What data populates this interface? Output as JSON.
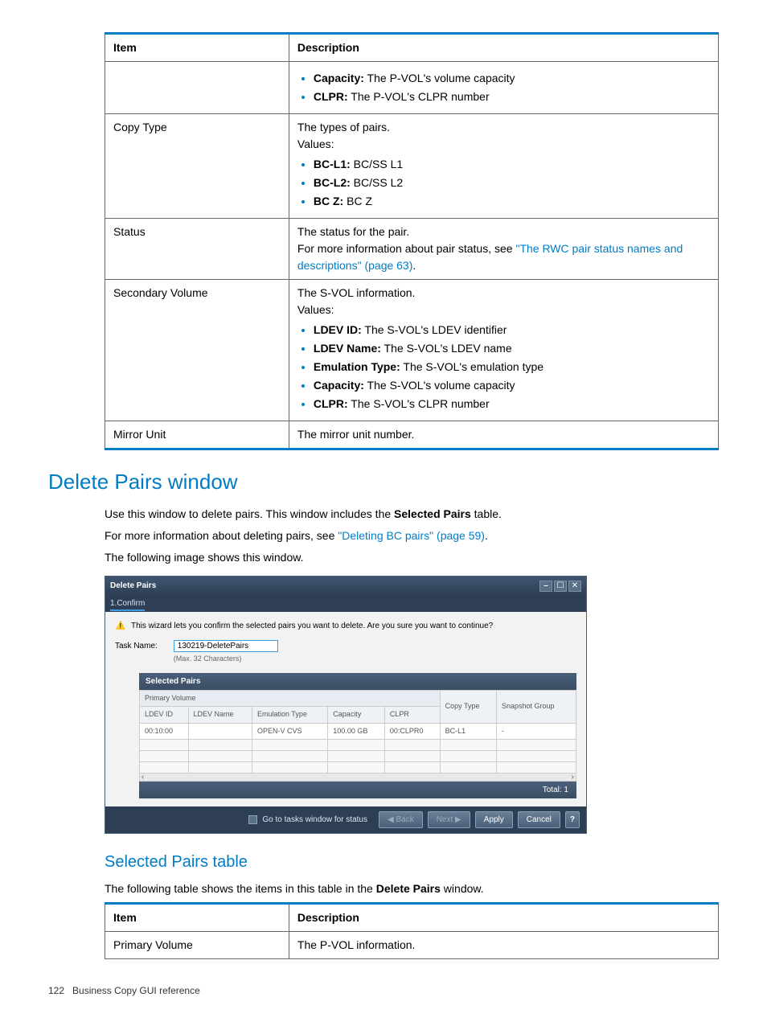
{
  "table1": {
    "headers": [
      "Item",
      "Description"
    ],
    "rows": [
      {
        "item": "",
        "bullets": [
          {
            "b": "Capacity:",
            "t": " The P-VOL's volume capacity"
          },
          {
            "b": "CLPR:",
            "t": " The P-VOL's CLPR number"
          }
        ]
      },
      {
        "item": "Copy Type",
        "lead": [
          "The types of pairs.",
          "Values:"
        ],
        "bullets": [
          {
            "b": "BC-L1:",
            "t": " BC/SS L1"
          },
          {
            "b": "BC-L2:",
            "t": " BC/SS L2"
          },
          {
            "b": "BC Z:",
            "t": " BC Z"
          }
        ]
      },
      {
        "item": "Status",
        "plain": "The status for the pair.",
        "linklead": "For more information about pair status, see ",
        "link": "\"The RWC pair status names and descriptions\" (page 63)",
        "tail": "."
      },
      {
        "item": "Secondary Volume",
        "lead": [
          "The S-VOL information.",
          "Values:"
        ],
        "bullets": [
          {
            "b": "LDEV ID:",
            "t": " The S-VOL's LDEV identifier"
          },
          {
            "b": "LDEV Name:",
            "t": " The S-VOL's LDEV name"
          },
          {
            "b": "Emulation Type:",
            "t": " The S-VOL's emulation type"
          },
          {
            "b": "Capacity:",
            "t": " The S-VOL's volume capacity"
          },
          {
            "b": "CLPR:",
            "t": " The S-VOL's CLPR number"
          }
        ]
      },
      {
        "item": "Mirror Unit",
        "plain": "The mirror unit number."
      }
    ]
  },
  "section": {
    "h2": "Delete Pairs window",
    "p1a": "Use this window to delete pairs. This window includes the ",
    "p1b": "Selected Pairs",
    "p1c": " table.",
    "p2a": "For more information about deleting pairs, see ",
    "p2link": "\"Deleting BC pairs\" (page 59)",
    "p2b": ".",
    "p3": "The following image shows this window."
  },
  "dialog": {
    "title": "Delete Pairs",
    "tab": "1.Confirm",
    "warn": "This wizard lets you confirm the selected pairs you want to delete. Are you sure you want to continue?",
    "task_label": "Task Name:",
    "task_value": "130219-DeletePairs",
    "task_hint": "(Max. 32 Characters)",
    "sp_title": "Selected Pairs",
    "group1": "Primary Volume",
    "cols": [
      "LDEV ID",
      "LDEV Name",
      "Emulation Type",
      "Capacity",
      "CLPR",
      "Copy Type",
      "Snapshot Group"
    ],
    "row": [
      "00:10:00",
      "",
      "OPEN-V CVS",
      "100.00 GB",
      "00:CLPR0",
      "BC-L1",
      "-"
    ],
    "total": "Total: 1",
    "footer_chk": "Go to tasks window for status",
    "buttons": {
      "back": "◀ Back",
      "next": "Next ▶",
      "apply": "Apply",
      "cancel": "Cancel",
      "help": "?"
    }
  },
  "subsection": {
    "h3": "Selected Pairs table",
    "p1a": "The following table shows the items in this table in the ",
    "p1b": "Delete Pairs",
    "p1c": " window."
  },
  "table2": {
    "headers": [
      "Item",
      "Description"
    ],
    "rows": [
      {
        "item": "Primary Volume",
        "desc": "The P-VOL information."
      }
    ]
  },
  "footer": {
    "page": "122",
    "title": "Business Copy GUI reference"
  }
}
